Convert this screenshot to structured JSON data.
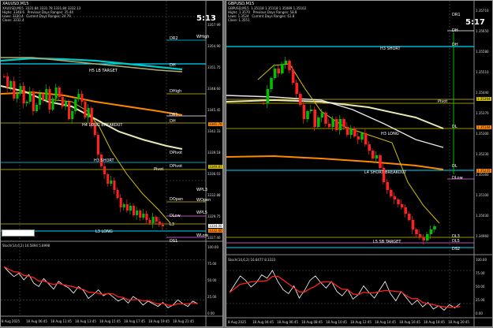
{
  "left": {
    "title": "XAUUSD,M15",
    "ohlc": "XAUUSD,M15  3331.84 3331.78 3331.84 3332.13",
    "info1": "Highs: 3348.6   Previous Days Ranges: 35.44",
    "info2": "Lows: 3330.4   Current Days Ranges: 24.79",
    "info3": "Close: 3332.4",
    "clock": "5:13",
    "y_ticks": [
      "3357.99",
      "3354.90",
      "3351.75",
      "3348.60",
      "3345.45",
      "3342.33",
      "3339.18",
      "3336.03",
      "3332.88",
      "3329.75",
      "3327.40"
    ],
    "stoch_ticks": [
      "100.00",
      "75.00",
      "50.00",
      "25.00",
      "0.00"
    ],
    "stoch_label": "Stoch(14,6,2) 16.5894 5.8998",
    "x_ticks": [
      "8 Aug 2025",
      "18 Aug 06:45",
      "18 Aug 11:45",
      "18 Aug 13:45",
      "18 Aug 15:45",
      "18 Aug 17:45",
      "18 Aug 19:45",
      "18 Aug 21:45"
    ],
    "levels": {
      "dr2": "DR2",
      "wh": "WHigh",
      "dh": "DH",
      "h5": "H5 LB TARGET",
      "dhigh": "DHigh",
      "dr1": "DR1",
      "dh2": "DH",
      "h4": "H4 LONG BREAKOUT",
      "h3": "H3 SHORT",
      "pivot": "Pivot",
      "dpivot": "DPivot",
      "dopen": "DOpen",
      "wpl3": "WPL3",
      "wopen": "WOpen",
      "dlow": "DLow",
      "wpl5": "WPL5",
      "l3": "L3",
      "l3long": "L3 LONG",
      "wlow": "WLow",
      "ds1": "DS1"
    },
    "tags": {
      "t1": "3341.76",
      "t2": "3349.87",
      "t3": "3334.00",
      "t4": "3332.80"
    }
  },
  "right": {
    "title": "GBPUSD,M15",
    "ohlc": "GBPUSD,M15  1.35118 1.35118 1.35089 1.35102",
    "info1": "Highs: 1.3570   Previous Days Ranges: 58.8",
    "info2": "Lows: 1.3524   Current Days Ranges: 61.8",
    "info3": "Close: 1.3551",
    "clock": "5:17",
    "y_ticks": [
      "1.35710",
      "1.35650",
      "1.35580",
      "1.35510",
      "1.35440",
      "1.35370",
      "1.35300",
      "1.35230",
      "1.35160",
      "1.35100",
      "1.35030",
      "1.34960"
    ],
    "stoch_ticks": [
      "100.00",
      "75.00",
      "50.00",
      "25.00",
      "0.00"
    ],
    "stoch_label": "Stoch(14,6,2) 16.6477 8.3333",
    "x_ticks": [
      "8 Aug 2025",
      "18 Aug 04:45",
      "18 Aug 06:45",
      "18 Aug 08:45",
      "18 Aug 10:45",
      "18 Aug 12:45",
      "18 Aug 14:45",
      "18 Aug 16:45",
      "18 Aug 18:45",
      "18 Aug 20:45"
    ],
    "levels": {
      "dr1": "DR1",
      "dh": "DH",
      "dh3": "DH",
      "h3": "H3 SHORT",
      "pivot": "Pivot",
      "dl": "DL",
      "h3long": "H3 LONG",
      "dl2": "DL",
      "l4": "L4 SHORT BREAKOUT",
      "dlow": "DLow",
      "dl3": "DL3",
      "dl4": "DL5",
      "l5": "L5 SB TARGET",
      "ds2": "DS2"
    },
    "tags": {
      "t1": "1.35394",
      "t2": "1.35144",
      "t3": "1.35225"
    }
  },
  "colors": {
    "bull": "#00c000",
    "bear": "#ff2020",
    "ma_fast": "#e8e8b0",
    "ma_slow": "#ff8800",
    "ma_cyan": "#00c8c8",
    "level_cyan": "#00d8ff",
    "level_yellow": "#d4c000"
  }
}
